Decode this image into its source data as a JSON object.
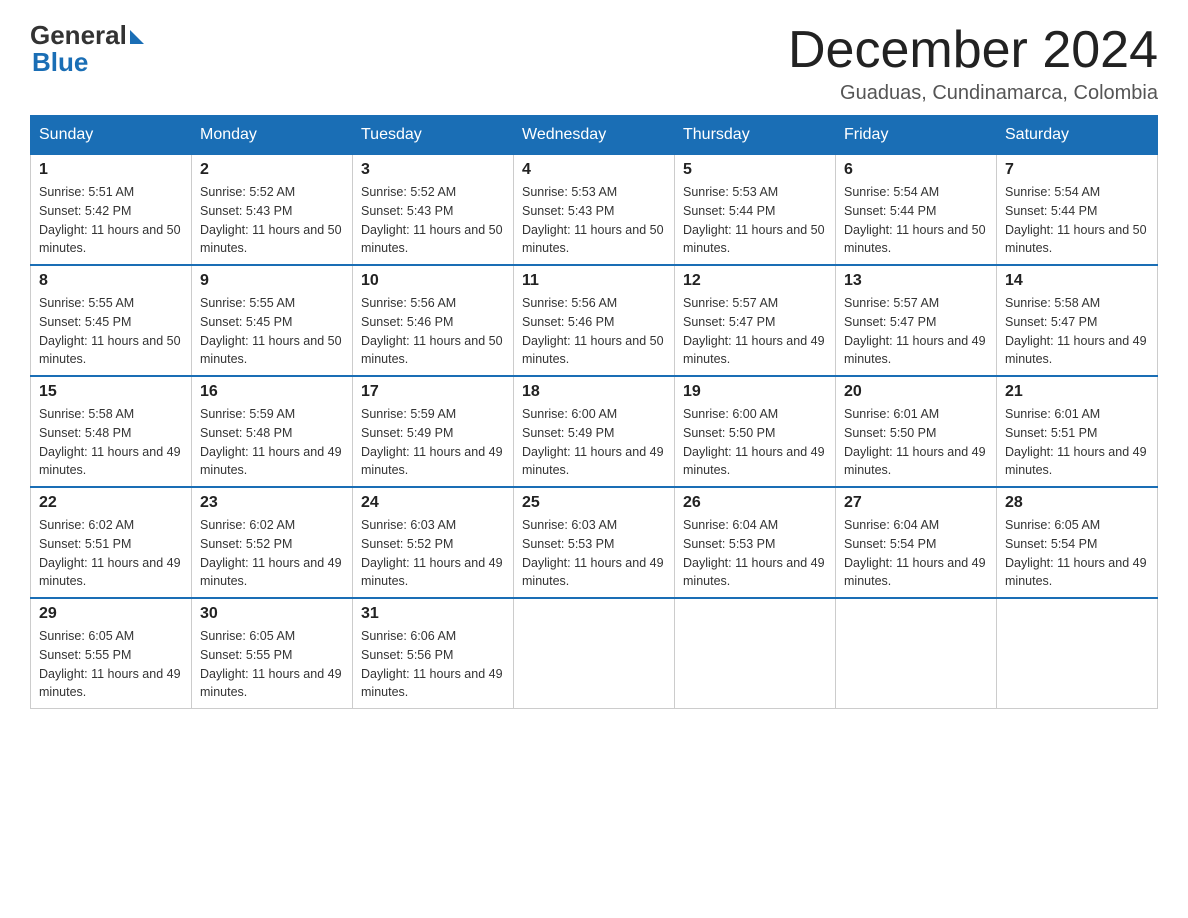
{
  "header": {
    "logo_general": "General",
    "logo_blue": "Blue",
    "month_title": "December 2024",
    "location": "Guaduas, Cundinamarca, Colombia"
  },
  "weekdays": [
    "Sunday",
    "Monday",
    "Tuesday",
    "Wednesday",
    "Thursday",
    "Friday",
    "Saturday"
  ],
  "weeks": [
    [
      {
        "day": "1",
        "sunrise": "5:51 AM",
        "sunset": "5:42 PM",
        "daylight": "11 hours and 50 minutes."
      },
      {
        "day": "2",
        "sunrise": "5:52 AM",
        "sunset": "5:43 PM",
        "daylight": "11 hours and 50 minutes."
      },
      {
        "day": "3",
        "sunrise": "5:52 AM",
        "sunset": "5:43 PM",
        "daylight": "11 hours and 50 minutes."
      },
      {
        "day": "4",
        "sunrise": "5:53 AM",
        "sunset": "5:43 PM",
        "daylight": "11 hours and 50 minutes."
      },
      {
        "day": "5",
        "sunrise": "5:53 AM",
        "sunset": "5:44 PM",
        "daylight": "11 hours and 50 minutes."
      },
      {
        "day": "6",
        "sunrise": "5:54 AM",
        "sunset": "5:44 PM",
        "daylight": "11 hours and 50 minutes."
      },
      {
        "day": "7",
        "sunrise": "5:54 AM",
        "sunset": "5:44 PM",
        "daylight": "11 hours and 50 minutes."
      }
    ],
    [
      {
        "day": "8",
        "sunrise": "5:55 AM",
        "sunset": "5:45 PM",
        "daylight": "11 hours and 50 minutes."
      },
      {
        "day": "9",
        "sunrise": "5:55 AM",
        "sunset": "5:45 PM",
        "daylight": "11 hours and 50 minutes."
      },
      {
        "day": "10",
        "sunrise": "5:56 AM",
        "sunset": "5:46 PM",
        "daylight": "11 hours and 50 minutes."
      },
      {
        "day": "11",
        "sunrise": "5:56 AM",
        "sunset": "5:46 PM",
        "daylight": "11 hours and 50 minutes."
      },
      {
        "day": "12",
        "sunrise": "5:57 AM",
        "sunset": "5:47 PM",
        "daylight": "11 hours and 49 minutes."
      },
      {
        "day": "13",
        "sunrise": "5:57 AM",
        "sunset": "5:47 PM",
        "daylight": "11 hours and 49 minutes."
      },
      {
        "day": "14",
        "sunrise": "5:58 AM",
        "sunset": "5:47 PM",
        "daylight": "11 hours and 49 minutes."
      }
    ],
    [
      {
        "day": "15",
        "sunrise": "5:58 AM",
        "sunset": "5:48 PM",
        "daylight": "11 hours and 49 minutes."
      },
      {
        "day": "16",
        "sunrise": "5:59 AM",
        "sunset": "5:48 PM",
        "daylight": "11 hours and 49 minutes."
      },
      {
        "day": "17",
        "sunrise": "5:59 AM",
        "sunset": "5:49 PM",
        "daylight": "11 hours and 49 minutes."
      },
      {
        "day": "18",
        "sunrise": "6:00 AM",
        "sunset": "5:49 PM",
        "daylight": "11 hours and 49 minutes."
      },
      {
        "day": "19",
        "sunrise": "6:00 AM",
        "sunset": "5:50 PM",
        "daylight": "11 hours and 49 minutes."
      },
      {
        "day": "20",
        "sunrise": "6:01 AM",
        "sunset": "5:50 PM",
        "daylight": "11 hours and 49 minutes."
      },
      {
        "day": "21",
        "sunrise": "6:01 AM",
        "sunset": "5:51 PM",
        "daylight": "11 hours and 49 minutes."
      }
    ],
    [
      {
        "day": "22",
        "sunrise": "6:02 AM",
        "sunset": "5:51 PM",
        "daylight": "11 hours and 49 minutes."
      },
      {
        "day": "23",
        "sunrise": "6:02 AM",
        "sunset": "5:52 PM",
        "daylight": "11 hours and 49 minutes."
      },
      {
        "day": "24",
        "sunrise": "6:03 AM",
        "sunset": "5:52 PM",
        "daylight": "11 hours and 49 minutes."
      },
      {
        "day": "25",
        "sunrise": "6:03 AM",
        "sunset": "5:53 PM",
        "daylight": "11 hours and 49 minutes."
      },
      {
        "day": "26",
        "sunrise": "6:04 AM",
        "sunset": "5:53 PM",
        "daylight": "11 hours and 49 minutes."
      },
      {
        "day": "27",
        "sunrise": "6:04 AM",
        "sunset": "5:54 PM",
        "daylight": "11 hours and 49 minutes."
      },
      {
        "day": "28",
        "sunrise": "6:05 AM",
        "sunset": "5:54 PM",
        "daylight": "11 hours and 49 minutes."
      }
    ],
    [
      {
        "day": "29",
        "sunrise": "6:05 AM",
        "sunset": "5:55 PM",
        "daylight": "11 hours and 49 minutes."
      },
      {
        "day": "30",
        "sunrise": "6:05 AM",
        "sunset": "5:55 PM",
        "daylight": "11 hours and 49 minutes."
      },
      {
        "day": "31",
        "sunrise": "6:06 AM",
        "sunset": "5:56 PM",
        "daylight": "11 hours and 49 minutes."
      },
      null,
      null,
      null,
      null
    ]
  ]
}
